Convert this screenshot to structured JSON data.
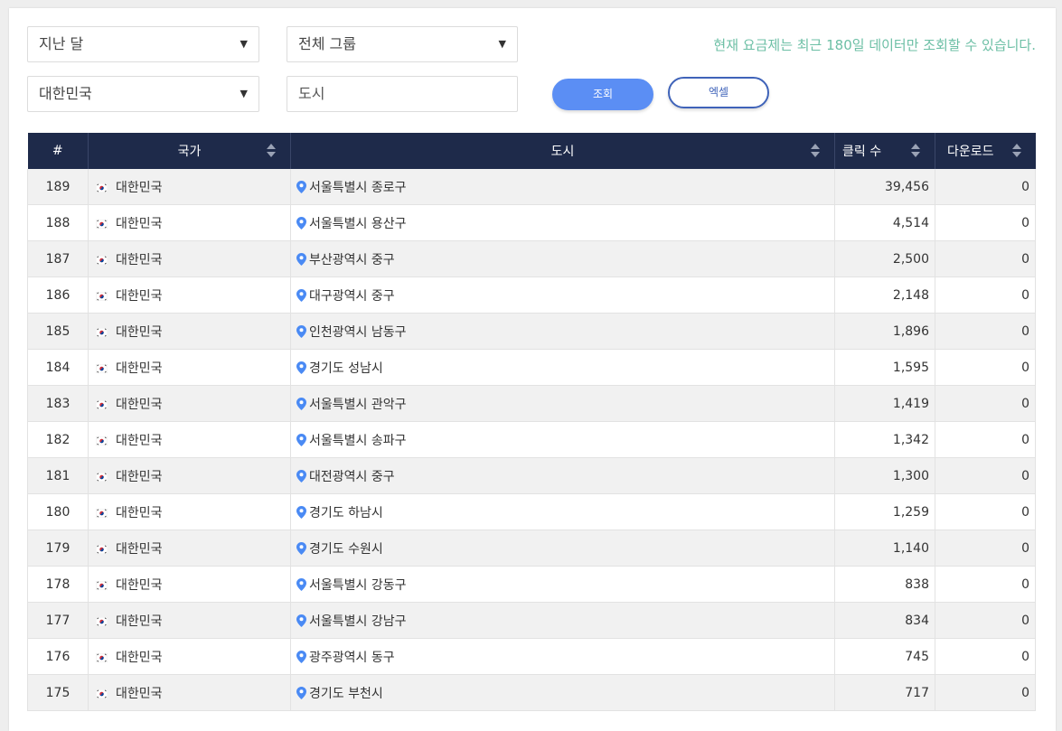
{
  "filters": {
    "period": "지난 달",
    "group": "전체 그룹",
    "country": "대한민국",
    "city_placeholder": "도시"
  },
  "notice": "현재 요금제는 최근 180일 데이터만 조회할 수 있습니다.",
  "buttons": {
    "query": "조회",
    "excel": "엑셀"
  },
  "colors": {
    "header_bg": "#1e2a4a",
    "primary": "#5b8ef4",
    "notice": "#6cbfa5"
  },
  "table": {
    "headers": {
      "index": "#",
      "country": "국가",
      "city": "도시",
      "clicks": "클릭 수",
      "downloads": "다운로드"
    },
    "rows": [
      {
        "index": "189",
        "country": "대한민국",
        "city": "서울특별시 종로구",
        "clicks": "39,456",
        "downloads": "0"
      },
      {
        "index": "188",
        "country": "대한민국",
        "city": "서울특별시 용산구",
        "clicks": "4,514",
        "downloads": "0"
      },
      {
        "index": "187",
        "country": "대한민국",
        "city": "부산광역시 중구",
        "clicks": "2,500",
        "downloads": "0"
      },
      {
        "index": "186",
        "country": "대한민국",
        "city": "대구광역시 중구",
        "clicks": "2,148",
        "downloads": "0"
      },
      {
        "index": "185",
        "country": "대한민국",
        "city": "인천광역시 남동구",
        "clicks": "1,896",
        "downloads": "0"
      },
      {
        "index": "184",
        "country": "대한민국",
        "city": "경기도 성남시",
        "clicks": "1,595",
        "downloads": "0"
      },
      {
        "index": "183",
        "country": "대한민국",
        "city": "서울특별시 관악구",
        "clicks": "1,419",
        "downloads": "0"
      },
      {
        "index": "182",
        "country": "대한민국",
        "city": "서울특별시 송파구",
        "clicks": "1,342",
        "downloads": "0"
      },
      {
        "index": "181",
        "country": "대한민국",
        "city": "대전광역시 중구",
        "clicks": "1,300",
        "downloads": "0"
      },
      {
        "index": "180",
        "country": "대한민국",
        "city": "경기도 하남시",
        "clicks": "1,259",
        "downloads": "0"
      },
      {
        "index": "179",
        "country": "대한민국",
        "city": "경기도 수원시",
        "clicks": "1,140",
        "downloads": "0"
      },
      {
        "index": "178",
        "country": "대한민국",
        "city": "서울특별시 강동구",
        "clicks": "838",
        "downloads": "0"
      },
      {
        "index": "177",
        "country": "대한민국",
        "city": "서울특별시 강남구",
        "clicks": "834",
        "downloads": "0"
      },
      {
        "index": "176",
        "country": "대한민국",
        "city": "광주광역시 동구",
        "clicks": "745",
        "downloads": "0"
      },
      {
        "index": "175",
        "country": "대한민국",
        "city": "경기도 부천시",
        "clicks": "717",
        "downloads": "0"
      }
    ]
  }
}
